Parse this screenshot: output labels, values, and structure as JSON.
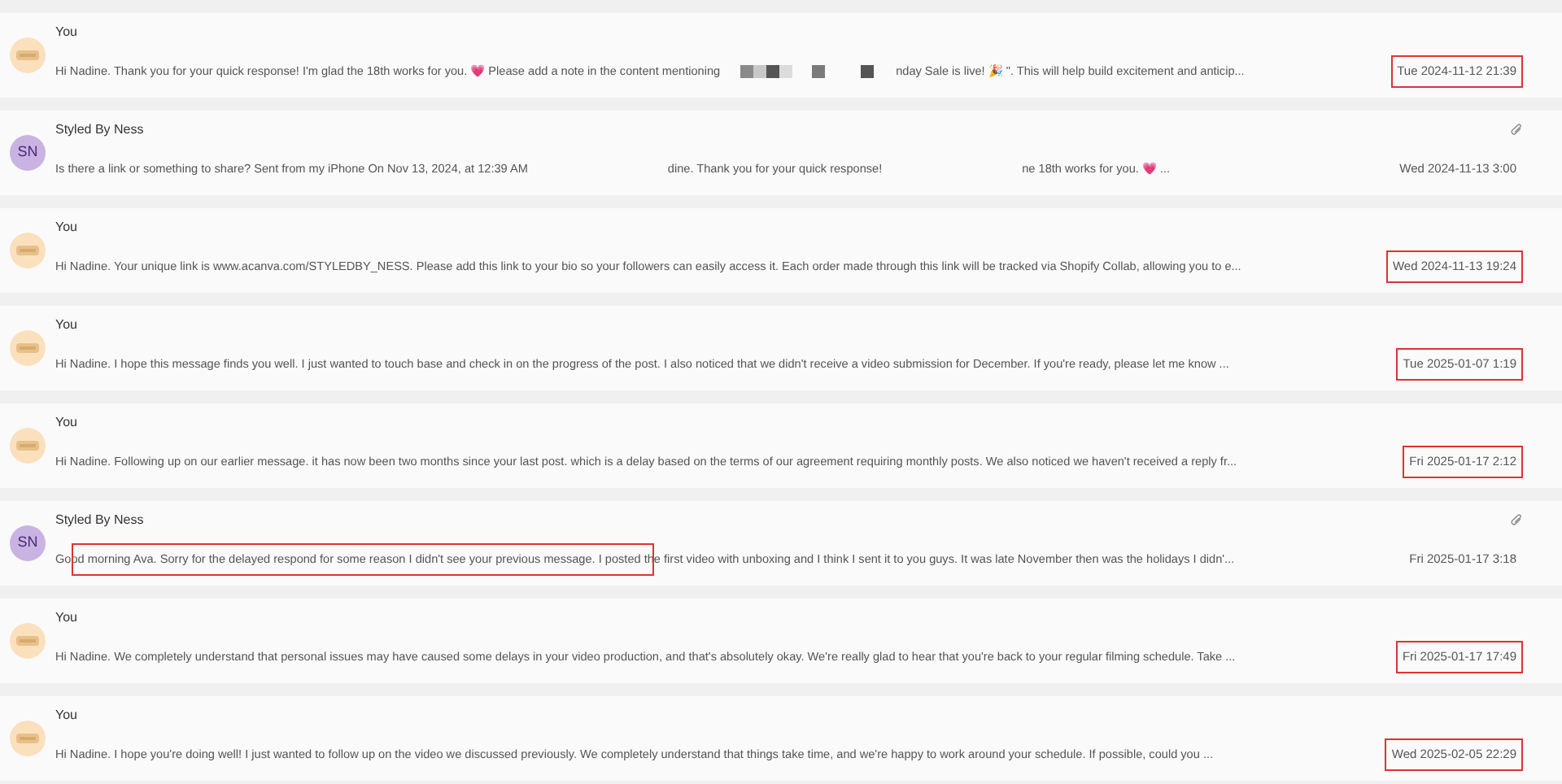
{
  "messages": [
    {
      "sender": "You",
      "preview_parts": [
        {
          "kind": "text",
          "text": "Hi Nadine. Thank you for your quick response! I'm glad the 18th works for you. 💗 Please add a note in the content mentioning"
        },
        {
          "kind": "redacted_blocks"
        },
        {
          "kind": "text",
          "text": "nday Sale is live! 🎉 \". This will help build excitement and anticip..."
        }
      ],
      "date": "Tue 2024-11-12 21:39",
      "attachment": false,
      "date_outlined": true,
      "preview_outlined": false
    },
    {
      "sender": "Styled By Ness",
      "avatar": {
        "kind": "initials",
        "initials": "SN"
      },
      "preview_parts": [
        {
          "kind": "text",
          "text": "Is there a link or something to share? Sent from my iPhone On Nov 13, 2024, at 12:39 AM"
        },
        {
          "kind": "redacted_blur"
        },
        {
          "kind": "text",
          "text": "dine. Thank you for your quick response!"
        },
        {
          "kind": "redacted_blur"
        },
        {
          "kind": "text",
          "text": "ne 18th works for you. 💗 ..."
        }
      ],
      "date": "Wed 2024-11-13 3:00",
      "attachment": true,
      "date_outlined": false,
      "preview_outlined": false
    },
    {
      "sender": "You",
      "preview_parts": [
        {
          "kind": "text",
          "text": "Hi Nadine. Your unique link is www.acanva.com/STYLEDBY_NESS. Please add this link to your bio so your followers can easily access it. Each order made through this link will be tracked via Shopify Collab, allowing you to e..."
        }
      ],
      "date": "Wed 2024-11-13 19:24",
      "attachment": false,
      "date_outlined": true,
      "preview_outlined": false
    },
    {
      "sender": "You",
      "preview_parts": [
        {
          "kind": "text",
          "text": "Hi Nadine. I hope this message finds you well. I just wanted to touch base and check in on the progress of the post. I also noticed that we didn't receive a video submission for December. If you're ready, please let me know ..."
        }
      ],
      "date": "Tue 2025-01-07 1:19",
      "attachment": false,
      "date_outlined": true,
      "preview_outlined": false
    },
    {
      "sender": "You",
      "preview_parts": [
        {
          "kind": "text",
          "text": "Hi Nadine. Following up on our earlier message. it has now been two months since your last post. which is a delay based on the terms of our agreement requiring monthly posts. We also noticed we haven't received a reply fr..."
        }
      ],
      "date": "Fri 2025-01-17 2:12",
      "attachment": false,
      "date_outlined": true,
      "preview_outlined": false
    },
    {
      "sender": "Styled By Ness",
      "avatar": {
        "kind": "initials",
        "initials": "SN"
      },
      "preview_parts": [
        {
          "kind": "text",
          "text": "Good morning Ava. Sorry for the delayed respond for some reason I didn't see your previous message. I posted the first video with unboxing and I think I sent it to you guys. It was late November then was the holidays I didn'..."
        }
      ],
      "date": "Fri 2025-01-17 3:18",
      "attachment": true,
      "date_outlined": false,
      "preview_outlined": true
    },
    {
      "sender": "You",
      "preview_parts": [
        {
          "kind": "text",
          "text": "Hi Nadine. We completely understand that personal issues may have caused some delays in your video production, and that's absolutely okay. We're really glad to hear that you're back to your regular filming schedule. Take ..."
        }
      ],
      "date": "Fri 2025-01-17 17:49",
      "attachment": false,
      "date_outlined": true,
      "preview_outlined": false
    },
    {
      "sender": "You",
      "preview_parts": [
        {
          "kind": "text",
          "text": "Hi Nadine. I hope you're doing well! I just wanted to follow up on the video we discussed previously. We completely understand that things take time, and we're happy to work around your schedule. If possible, could you ..."
        }
      ],
      "date": "Wed 2025-02-05 22:29",
      "attachment": false,
      "date_outlined": true,
      "preview_outlined": false
    }
  ]
}
